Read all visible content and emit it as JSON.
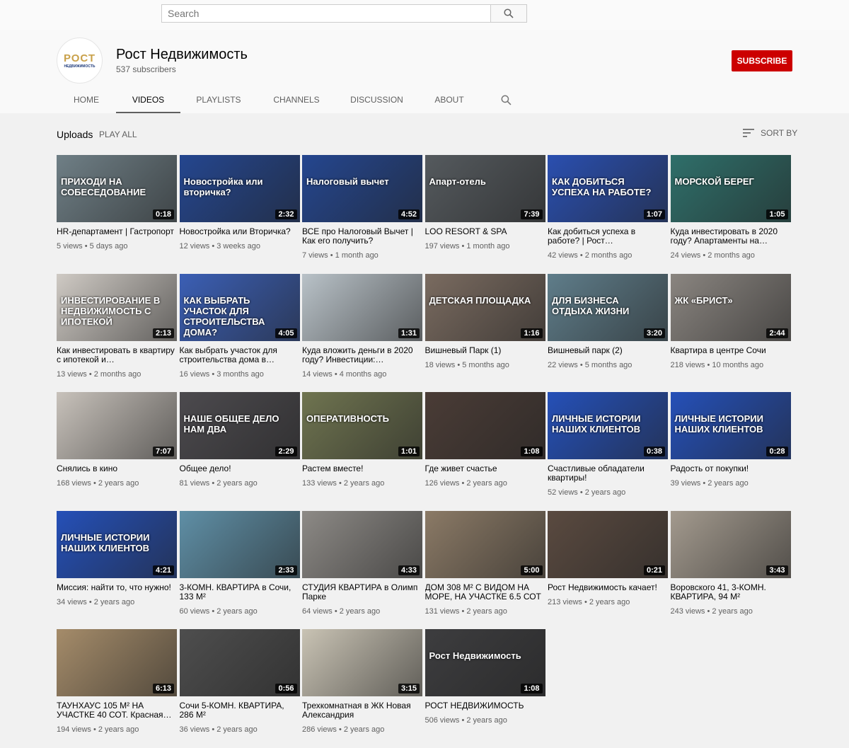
{
  "search": {
    "placeholder": "Search"
  },
  "channel": {
    "avatar_text": "РОСТ",
    "avatar_sub": "НЕДВИЖИМОСТЬ",
    "name": "Рост Недвижимость",
    "subscribers": "537 subscribers",
    "subscribe_label": "SUBSCRIBE",
    "accent": "#cc0000"
  },
  "tabs": [
    {
      "label": "HOME"
    },
    {
      "label": "VIDEOS",
      "active": true
    },
    {
      "label": "PLAYLISTS"
    },
    {
      "label": "CHANNELS"
    },
    {
      "label": "DISCUSSION"
    },
    {
      "label": "ABOUT"
    }
  ],
  "section": {
    "title": "Uploads",
    "play_all": "PLAY ALL",
    "sort_label": "SORT BY"
  },
  "videos": [
    {
      "title": "HR-департамент | Гастропорт",
      "meta": "5 views • 5 days ago",
      "duration": "0:18",
      "thumb_text": "ПРИХОДИ НА СОБЕСЕДОВАНИЕ",
      "color": "#6f7f86"
    },
    {
      "title": "Новостройка или Вторичка?",
      "meta": "12 views • 3 weeks ago",
      "duration": "2:32",
      "thumb_text": "Новостройка или вторичка?",
      "color": "#24468f"
    },
    {
      "title": "ВСЕ про Налоговый Вычет | Как его получить?",
      "meta": "7 views • 1 month ago",
      "duration": "4:52",
      "thumb_text": "Налоговый вычет",
      "color": "#24468f"
    },
    {
      "title": "LOO RESORT & SPA",
      "meta": "197 views • 1 month ago",
      "duration": "7:39",
      "thumb_text": "Апарт-отель",
      "color": "#555a5e"
    },
    {
      "title": "Как добиться успеха в работе? | Рост…",
      "meta": "42 views • 2 months ago",
      "duration": "1:07",
      "thumb_text": "КАК ДОБИТЬСЯ УСПЕХА НА РАБОТЕ?",
      "color": "#2a4fb0"
    },
    {
      "title": "Куда инвестировать в 2020 году? Апартаменты на…",
      "meta": "24 views • 2 months ago",
      "duration": "1:05",
      "thumb_text": "МОРСКОЙ БЕРЕГ",
      "color": "#2f6f6a"
    },
    {
      "title": "Как инвестировать в квартиру с ипотекой и…",
      "meta": "13 views • 2 months ago",
      "duration": "2:13",
      "thumb_text": "ИНВЕСТИРОВАНИЕ В НЕДВИЖИМОСТЬ С ИПОТЕКОЙ",
      "color": "#cfcac4"
    },
    {
      "title": "Как выбрать участок для строительства дома в…",
      "meta": "16 views • 3 months ago",
      "duration": "4:05",
      "thumb_text": "КАК ВЫБРАТЬ УЧАСТОК ДЛЯ СТРОИТЕЛЬСТВА ДОМА?",
      "color": "#3b5fb5"
    },
    {
      "title": "Куда вложить деньги в 2020 году? Инвестиции:…",
      "meta": "14 views • 4 months ago",
      "duration": "1:31",
      "thumb_text": "",
      "color": "#b9c2c8"
    },
    {
      "title": "Вишневый Парк (1)",
      "meta": "18 views • 5 months ago",
      "duration": "1:16",
      "thumb_text": "ДЕТСКАЯ ПЛОЩАДКА",
      "color": "#7a6b60"
    },
    {
      "title": "Вишневый парк (2)",
      "meta": "22 views • 5 months ago",
      "duration": "3:20",
      "thumb_text": "ДЛЯ БИЗНЕСА ОТДЫХА ЖИЗНИ",
      "color": "#5f7d8a"
    },
    {
      "title": "Квартира в центре Сочи",
      "meta": "218 views • 10 months ago",
      "duration": "2:44",
      "thumb_text": "ЖК «БРИСТ»",
      "color": "#8a8580"
    },
    {
      "title": "Снялись в кино",
      "meta": "168 views • 2 years ago",
      "duration": "7:07",
      "thumb_text": "",
      "color": "#c8c2bb"
    },
    {
      "title": "Общее дело!",
      "meta": "81 views • 2 years ago",
      "duration": "2:29",
      "thumb_text": "НАШЕ ОБЩЕЕ ДЕЛО НАМ ДВА",
      "color": "#4c4a4e"
    },
    {
      "title": "Растем вместе!",
      "meta": "133 views • 2 years ago",
      "duration": "1:01",
      "thumb_text": "ОПЕРАТИВНОСТЬ",
      "color": "#6f7450"
    },
    {
      "title": "Где живет счастье",
      "meta": "126 views • 2 years ago",
      "duration": "1:08",
      "thumb_text": "",
      "color": "#4a3c36"
    },
    {
      "title": "Счастливые обладатели квартиры!",
      "meta": "52 views • 2 years ago",
      "duration": "0:38",
      "thumb_text": "ЛИЧНЫЕ ИСТОРИИ НАШИХ КЛИЕНТОВ",
      "color": "#2550b8"
    },
    {
      "title": "Радость от покупки!",
      "meta": "39 views • 2 years ago",
      "duration": "0:28",
      "thumb_text": "ЛИЧНЫЕ ИСТОРИИ НАШИХ КЛИЕНТОВ",
      "color": "#2550b8"
    },
    {
      "title": "Миссия: найти то, что нужно!",
      "meta": "34 views • 2 years ago",
      "duration": "4:21",
      "thumb_text": "ЛИЧНЫЕ ИСТОРИИ НАШИХ КЛИЕНТОВ",
      "color": "#2550b8"
    },
    {
      "title": "3-КОМН. КВАРТИРА в Сочи, 133 М²",
      "meta": "60 views • 2 years ago",
      "duration": "2:33",
      "thumb_text": "",
      "color": "#5f8fa6"
    },
    {
      "title": "СТУДИЯ КВАРТИРА в Олимп Парке",
      "meta": "64 views • 2 years ago",
      "duration": "4:33",
      "thumb_text": "",
      "color": "#8d8a86"
    },
    {
      "title": "ДОМ 308 М² С ВИДОМ НА МОРЕ, НА УЧАСТКЕ 6.5 СОТ",
      "meta": "131 views • 2 years ago",
      "duration": "5:00",
      "thumb_text": "",
      "color": "#8b7a66"
    },
    {
      "title": "Рост Недвижимость качает!",
      "meta": "213 views • 2 years ago",
      "duration": "0:21",
      "thumb_text": "",
      "color": "#5a4a40"
    },
    {
      "title": "Воровского 41, 3-КОМН. КВАРТИРА, 94 М²",
      "meta": "243 views • 2 years ago",
      "duration": "3:43",
      "thumb_text": "",
      "color": "#a39a8e"
    },
    {
      "title": "ТАУНХАУС 105 М² НА УЧАСТКЕ 40 СОТ. Красная…",
      "meta": "194 views • 2 years ago",
      "duration": "6:13",
      "thumb_text": "",
      "color": "#a58c6a"
    },
    {
      "title": "Сочи 5-КОМН. КВАРТИРА, 286 М²",
      "meta": "36 views • 2 years ago",
      "duration": "0:56",
      "thumb_text": "",
      "color": "#4e4e4e"
    },
    {
      "title": "Трехкомнатная в ЖК Новая Александрия",
      "meta": "286 views • 2 years ago",
      "duration": "3:15",
      "thumb_text": "",
      "color": "#c9c3b4"
    },
    {
      "title": "РОСТ НЕДВИЖИМОСТЬ",
      "meta": "506 views • 2 years ago",
      "duration": "1:08",
      "thumb_text": "Рост Недвижимость",
      "color": "#3d3d3f"
    }
  ]
}
